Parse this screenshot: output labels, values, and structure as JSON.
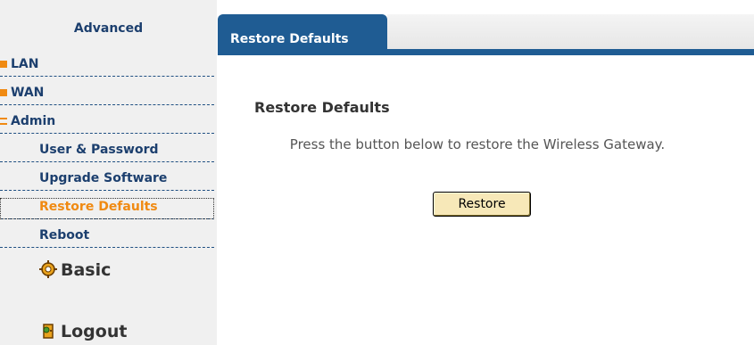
{
  "sidebar": {
    "title": "Advanced",
    "items": [
      {
        "label": "LAN"
      },
      {
        "label": "WAN"
      },
      {
        "label": "Admin"
      },
      {
        "label": "User & Password"
      },
      {
        "label": "Upgrade Software"
      },
      {
        "label": "Restore Defaults"
      },
      {
        "label": "Reboot"
      }
    ],
    "basic_label": "Basic",
    "logout_label": "Logout"
  },
  "tab": {
    "label": "Restore Defaults"
  },
  "main": {
    "title": "Restore Defaults",
    "description": "Press the button below to restore the Wireless Gateway.",
    "restore_button": "Restore"
  },
  "colors": {
    "nav_blue": "#1f5c93",
    "accent_orange": "#f08a12",
    "button_fill": "#f7e8b8"
  }
}
